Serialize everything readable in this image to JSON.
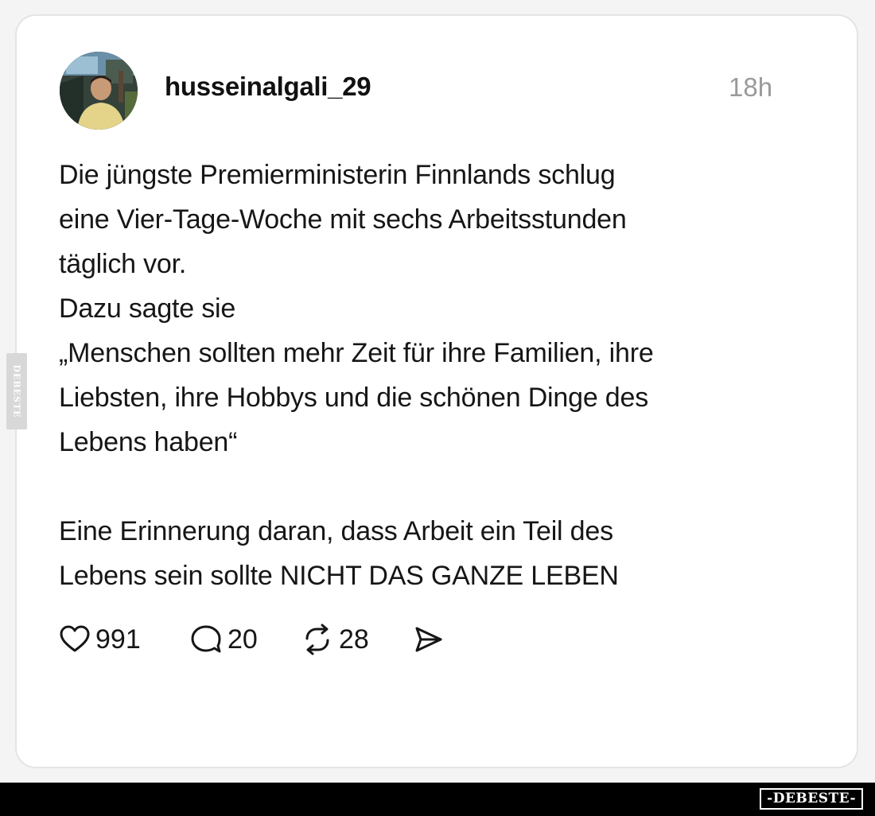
{
  "post": {
    "username": "husseinalgali_29",
    "time": "18h",
    "lines": [
      "Die jüngste Premierministerin Finnlands schlug",
      "eine Vier-Tage-Woche mit sechs Arbeitsstunden",
      "täglich vor.",
      "Dazu sagte sie",
      "„Menschen sollten mehr Zeit für ihre Familien, ihre",
      "Liebsten, ihre Hobbys und die schönen Dinge des",
      "Lebens haben“",
      "",
      "Eine Erinnerung daran, dass Arbeit ein Teil des",
      "Lebens sein sollte NICHT DAS GANZE LEBEN"
    ]
  },
  "actions": {
    "likes": "991",
    "comments": "20",
    "reposts": "28"
  },
  "icons": {
    "like": "heart-icon",
    "comment": "comment-bubble-icon",
    "repost": "repost-arrows-icon",
    "share": "send-icon"
  },
  "watermark": {
    "side": "DEBESTE",
    "footer": "-DEBESTE-"
  },
  "colors": {
    "text": "#161616",
    "muted": "#9a9a9a",
    "card_border": "#e4e4e4",
    "footer_bg": "#000000"
  }
}
